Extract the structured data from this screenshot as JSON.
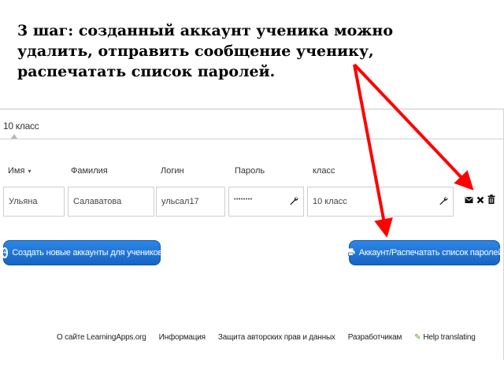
{
  "instruction": {
    "lines": [
      "3 шаг: созданный аккаунт ученика можно",
      "удалить, отправить сообщение ученику,",
      "распечатать список паролей."
    ]
  },
  "class_section": {
    "title": "10 класс"
  },
  "table": {
    "headers": [
      "Имя",
      "Фамилия",
      "Логин",
      "Пароль",
      "класс"
    ],
    "sort_icon": "▾",
    "row": {
      "first_name": "Ульяна",
      "last_name": "Салаватова",
      "login": "ульсал17",
      "password": "••••••••",
      "class": "10 класс"
    }
  },
  "icons": {
    "wrench": "wrench-icon",
    "message": "envelope-icon",
    "remove": "close-icon",
    "delete": "trash-icon"
  },
  "buttons": {
    "create": "Создать новые аккаунты для учеников",
    "print": "Аккаунт/Распечатать список паролей"
  },
  "footer": {
    "links": [
      "О сайте LearningApps.org",
      "Информация",
      "Защита авторских прав и данных",
      "Разработчикам",
      "Help translating"
    ]
  },
  "colors": {
    "arrow": "#ff0000",
    "button": "#1f6fd6"
  }
}
